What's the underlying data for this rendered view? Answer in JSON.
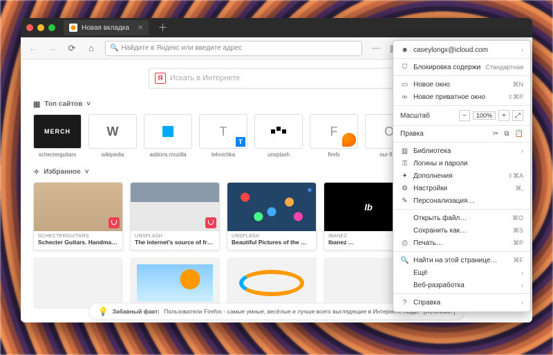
{
  "tab": {
    "title": "Новая вкладка"
  },
  "urlbar": {
    "placeholder": "Найдите в Яндекс или введите адрес"
  },
  "content_search": {
    "placeholder": "Искать в Интернете"
  },
  "sections": {
    "top_sites": "Топ сайтов",
    "highlights": "Избранное"
  },
  "top_sites": [
    {
      "label": "schecterguitars",
      "thumb": "MERCH"
    },
    {
      "label": "wikipedia",
      "thumb": "W"
    },
    {
      "label": "addons.mozilla",
      "thumb": "drop"
    },
    {
      "label": "tehnichka",
      "thumb": "T"
    },
    {
      "label": "unsplash",
      "thumb": "u"
    },
    {
      "label": "firefx",
      "thumb": "F"
    },
    {
      "label": "our-firef",
      "thumb": "O"
    }
  ],
  "cards": [
    {
      "source": "SCHECTERGUITARS",
      "title": "Schecter Guitars. Handmade, …"
    },
    {
      "source": "UNSPLASH",
      "title": "The internet's source of freely …"
    },
    {
      "source": "UNSPLASH",
      "title": "Beautiful Pictures of the Week…"
    },
    {
      "source": "IBANEZ",
      "title": "Ibanez …"
    }
  ],
  "fact": {
    "prefix": "Забавный факт:",
    "text": "Пользователи Firefox - самые умные, весёлые и лучше всего выглядящие в Интернете люди.",
    "source": "[Источник?]"
  },
  "menu": {
    "account": "caseylongx@icloud.com",
    "content_blocking": {
      "label": "Блокировка содержимого",
      "value": "Стандартная"
    },
    "new_window": {
      "label": "Новое окно",
      "shortcut": "⌘N"
    },
    "new_private": {
      "label": "Новое приватное окно",
      "shortcut": "⇧⌘P"
    },
    "zoom": {
      "label": "Масштаб",
      "value": "100%"
    },
    "edit": {
      "label": "Правка"
    },
    "library": "Библиотека",
    "logins": "Логины и пароли",
    "addons": {
      "label": "Дополнения",
      "shortcut": "⇧⌘A"
    },
    "prefs": {
      "label": "Настройки",
      "shortcut": "⌘,"
    },
    "customize": "Персонализация…",
    "open_file": {
      "label": "Открыть файл…",
      "shortcut": "⌘O"
    },
    "save_as": {
      "label": "Сохранить как…",
      "shortcut": "⌘S"
    },
    "print": {
      "label": "Печать…",
      "shortcut": "⌘P"
    },
    "find": {
      "label": "Найти на этой странице…",
      "shortcut": "⌘F"
    },
    "more": "Ещё",
    "webdev": "Веб-разработка",
    "help": "Справка"
  }
}
